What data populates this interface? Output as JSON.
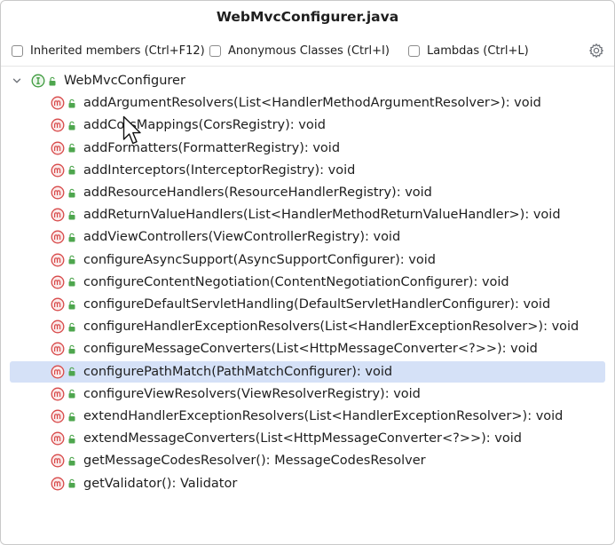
{
  "title": "WebMvcConfigurer.java",
  "filters": {
    "inherited": "Inherited members (Ctrl+F12)",
    "anonymous": "Anonymous Classes (Ctrl+I)",
    "lambdas": "Lambdas (Ctrl+L)"
  },
  "icons": {
    "settings": "gear-icon",
    "interface": "interface-icon",
    "method": "method-icon",
    "visibility": "public-lock-icon",
    "expand": "chevron-down-icon"
  },
  "colors": {
    "method_icon": "#d84a4a",
    "interface_icon": "#3f9b3f",
    "lock": "#4ea64e",
    "selection": "#d5e1f7"
  },
  "tree": {
    "root": "WebMvcConfigurer",
    "items": [
      "addArgumentResolvers(List<HandlerMethodArgumentResolver>): void",
      "addCorsMappings(CorsRegistry): void",
      "addFormatters(FormatterRegistry): void",
      "addInterceptors(InterceptorRegistry): void",
      "addResourceHandlers(ResourceHandlerRegistry): void",
      "addReturnValueHandlers(List<HandlerMethodReturnValueHandler>): void",
      "addViewControllers(ViewControllerRegistry): void",
      "configureAsyncSupport(AsyncSupportConfigurer): void",
      "configureContentNegotiation(ContentNegotiationConfigurer): void",
      "configureDefaultServletHandling(DefaultServletHandlerConfigurer): void",
      "configureHandlerExceptionResolvers(List<HandlerExceptionResolver>): void",
      "configureMessageConverters(List<HttpMessageConverter<?>>): void",
      "configurePathMatch(PathMatchConfigurer): void",
      "configureViewResolvers(ViewResolverRegistry): void",
      "extendHandlerExceptionResolvers(List<HandlerExceptionResolver>): void",
      "extendMessageConverters(List<HttpMessageConverter<?>>): void",
      "getMessageCodesResolver(): MessageCodesResolver",
      "getValidator(): Validator"
    ],
    "selected": "configurePathMatch(PathMatchConfigurer): void"
  }
}
